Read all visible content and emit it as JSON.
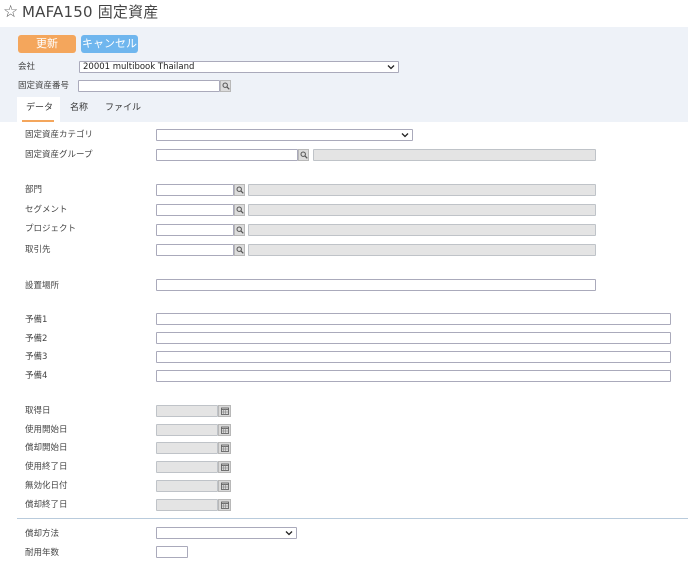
{
  "header": {
    "title": "MAFA150 固定資産",
    "star_icon": "star-outline-icon"
  },
  "toolbar": {
    "update_label": "更新",
    "cancel_label": "キャンセル",
    "update_color": "#f4a65c",
    "cancel_color": "#6fb6ee"
  },
  "top_fields": {
    "company_label": "会社",
    "company_value": "20001 multibook Thailand",
    "asset_number_label": "固定資産番号",
    "asset_number_value": ""
  },
  "tabs": [
    {
      "label": "データ",
      "active": true
    },
    {
      "label": "名称",
      "active": false
    },
    {
      "label": "ファイル",
      "active": false
    }
  ],
  "form": {
    "category_label": "固定資産カテゴリ",
    "group_label": "固定資産グループ",
    "department_label": "部門",
    "segment_label": "セグメント",
    "project_label": "プロジェクト",
    "partner_label": "取引先",
    "location_label": "設置場所",
    "reserve1_label": "予備1",
    "reserve2_label": "予備2",
    "reserve3_label": "予備3",
    "reserve4_label": "予備4",
    "acquisition_date_label": "取得日",
    "use_start_date_label": "使用開始日",
    "depreciation_start_date_label": "償却開始日",
    "use_end_date_label": "使用終了日",
    "invalidation_date_label": "無効化日付",
    "depreciation_end_date_label": "償却終了日",
    "depreciation_method_label": "償却方法",
    "useful_life_label": "耐用年数"
  }
}
